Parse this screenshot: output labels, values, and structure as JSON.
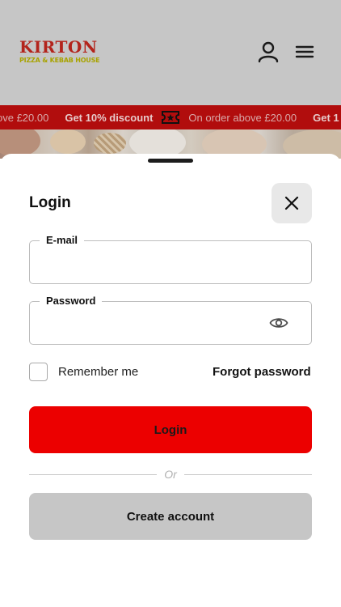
{
  "brand": {
    "name": "KIRTON",
    "tagline": "PIZZA & KEBAB HOUSE"
  },
  "header": {
    "user_icon": "user-icon",
    "menu_icon": "hamburger-menu-icon"
  },
  "promo": {
    "items": [
      {
        "kind": "text",
        "text": "ove £20.00"
      },
      {
        "kind": "strong",
        "text": "Get 10% discount"
      },
      {
        "kind": "text",
        "text": "On order above £20.00"
      },
      {
        "kind": "strong",
        "text": "Get 1"
      }
    ],
    "icon": "ticket-star-icon"
  },
  "login": {
    "title": "Login",
    "email_label": "E-mail",
    "email_value": "",
    "password_label": "Password",
    "password_value": "",
    "remember_label": "Remember me",
    "remember_checked": false,
    "forgot_label": "Forgot password",
    "login_button": "Login",
    "divider_text": "Or",
    "create_button": "Create account"
  },
  "colors": {
    "accent_red": "#ec0000",
    "promo_bg": "#b10d0d",
    "secondary_button": "#c6c6c6"
  }
}
